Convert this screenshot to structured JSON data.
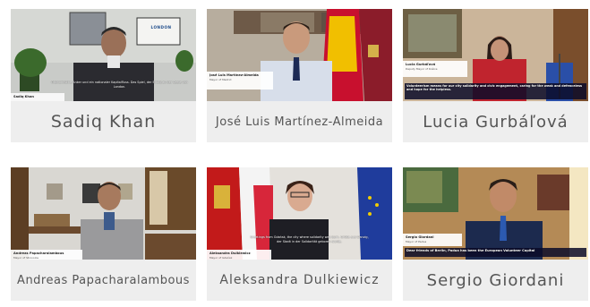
{
  "participants": [
    {
      "name": "Sadiq Khan",
      "overlay_name": "Sadiq Khan",
      "overlay_role": "",
      "caption": "Ökonomische Anker und ein nationaler Kapitalfluss. Das Spiel, der Erfolg zu der Seele von London.",
      "backdrop_text": "LONDON"
    },
    {
      "name": "José Luis Martínez-Almeida",
      "overlay_name": "José Luis Martínez-Almeida",
      "overlay_role": "Mayor of Madrid",
      "caption": ""
    },
    {
      "name": "Lucia Gurbáľová",
      "overlay_name": "Lucia Gurbáľová",
      "overlay_role": "Deputy Mayor of Košice",
      "caption": "Volunteerism means for our city solidarity and civic engagement, caring for the weak and defenceless and hope for the helpless."
    },
    {
      "name": "Andreas Papacharalambous",
      "overlay_name": "Andreas Papacharalambous",
      "overlay_role": "Mayor of Strovolos",
      "caption": ""
    },
    {
      "name": "Aleksandra Dulkiewicz",
      "overlay_name": "Aleksandra Dulkiewicz",
      "overlay_role": "Mayor of Gdańsk",
      "caption": "Greetings from Gdańsk, the city where solidarity was born. Grüße aus Danzig, der Stadt in der Solidarität geboren wurde."
    },
    {
      "name": "Sergio Giordani",
      "overlay_name": "Sergio Giordani",
      "overlay_role": "Mayor of Padua",
      "caption": "Dear friends of Berlin, Padua has been the European Volunteer Capital"
    }
  ],
  "colors": {
    "name_text": "#555555",
    "name_bar_bg": "#eeeeee"
  }
}
